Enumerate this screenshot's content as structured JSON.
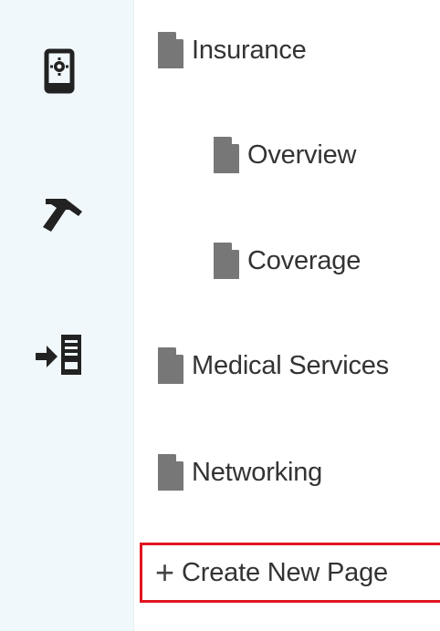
{
  "rail": {
    "items": [
      {
        "icon": "mobile-settings-icon"
      },
      {
        "icon": "hammer-icon"
      },
      {
        "icon": "deploy-server-icon"
      }
    ]
  },
  "pages": [
    {
      "label": "Insurance",
      "level": 0,
      "icon": "page-icon"
    },
    {
      "label": "Overview",
      "level": 1,
      "icon": "page-icon"
    },
    {
      "label": "Coverage",
      "level": 1,
      "icon": "page-icon"
    },
    {
      "label": "Medical Services",
      "level": 0,
      "icon": "page-icon"
    },
    {
      "label": "Networking",
      "level": 0,
      "icon": "page-icon"
    }
  ],
  "create": {
    "icon": "plus",
    "label": "Create New Page"
  },
  "colors": {
    "rail_bg": "#f0f8fb",
    "highlight_border": "#e0151f",
    "text": "#333333",
    "icon": "#777777"
  }
}
